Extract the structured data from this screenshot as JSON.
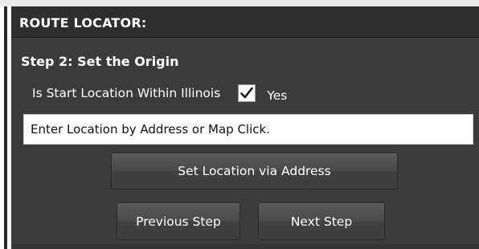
{
  "panel": {
    "title": "ROUTE LOCATOR:",
    "step_title": "Step 2:  Set the Origin"
  },
  "question": {
    "label": "Is Start Location Within Illinois",
    "checked": true,
    "option_label": "Yes"
  },
  "location_input": {
    "value": "Enter Location by Address or Map Click."
  },
  "buttons": {
    "set_location": "Set Location via Address",
    "previous": "Previous Step",
    "next": "Next Step"
  },
  "colors": {
    "panel_background": "#3b3b3b",
    "header_background": "#2e2e2e",
    "text": "#ffffff"
  },
  "icons": {
    "checkbox_mark": "checkmark-icon"
  }
}
